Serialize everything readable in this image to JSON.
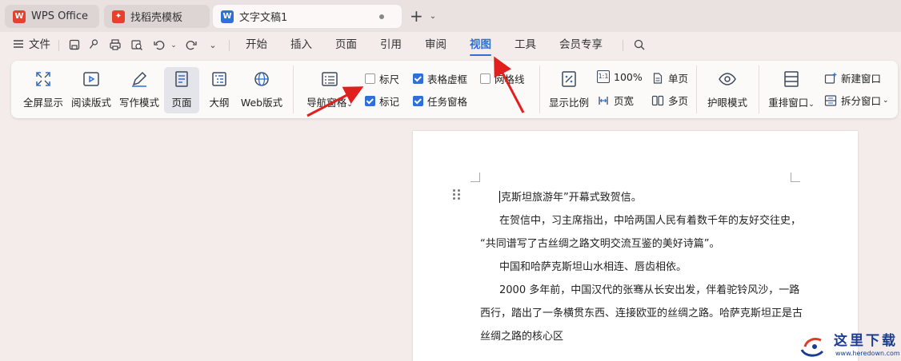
{
  "tabs": [
    {
      "label": "WPS Office",
      "logo": "W",
      "logo_color": "#e6412e"
    },
    {
      "label": "找稻壳模板",
      "logo": "✦",
      "logo_color": "#e6412e"
    },
    {
      "label": "文字文稿1",
      "logo": "W",
      "logo_color": "#2f6fd6"
    }
  ],
  "newtab": {
    "plus": "+",
    "dropdown": "⌄"
  },
  "menu": {
    "file": "文件",
    "tabs": [
      "开始",
      "插入",
      "页面",
      "引用",
      "审阅",
      "视图",
      "工具",
      "会员专享"
    ],
    "active_tab": "视图"
  },
  "ribbon": {
    "views": [
      {
        "label": "全屏显示",
        "icon": "fullscreen-icon"
      },
      {
        "label": "阅读版式",
        "icon": "read-mode-icon"
      },
      {
        "label": "写作模式",
        "icon": "pen-icon"
      },
      {
        "label": "页面",
        "icon": "page-view-icon"
      },
      {
        "label": "大纲",
        "icon": "outline-icon"
      },
      {
        "label": "Web版式",
        "icon": "globe-icon"
      }
    ],
    "nav_pane": {
      "label": "导航窗格",
      "dropdown": "⌄"
    },
    "checks": [
      {
        "label": "标尺",
        "checked": false
      },
      {
        "label": "表格虚框",
        "checked": true
      },
      {
        "label": "网格线",
        "checked": false
      },
      {
        "label": "标记",
        "checked": true
      },
      {
        "label": "任务窗格",
        "checked": true
      }
    ],
    "zoom": {
      "label": "显示比例",
      "percent": "100%",
      "page_width": "页宽",
      "single": "单页",
      "multi": "多页",
      "ratio_glyph": "1:1"
    },
    "eye": {
      "label": "护眼模式"
    },
    "window": {
      "rearrange": "重排窗口",
      "new_window": "新建窗口",
      "split": "拆分窗口",
      "dropdown": "⌄"
    }
  },
  "document": {
    "lines": [
      "克斯坦旅游年”开幕式致贺信。",
      "在贺信中，习主席指出，中哈两国人民有着数千年的友好交往史，",
      "“共同谱写了古丝绸之路文明交流互鉴的美好诗篇”。",
      "中国和哈萨克斯坦山水相连、唇齿相依。",
      "2000 多年前，中国汉代的张骞从长安出发，伴着驼铃风沙，一路",
      "西行，踏出了一条横贯东西、连接欧亚的丝绸之路。哈萨克斯坦正是古",
      "丝绸之路的核心区"
    ]
  },
  "watermark": {
    "title": "这里下载",
    "url": "www.heredown.com"
  },
  "colors": {
    "accent": "#2f6fd6",
    "annotation_arrow": "#e01f1f",
    "background": "#f3ecea"
  }
}
